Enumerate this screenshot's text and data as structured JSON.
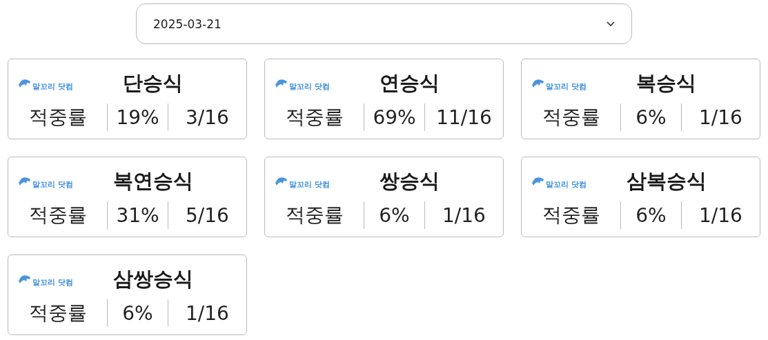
{
  "date_select": {
    "value": "2025-03-21"
  },
  "cards": [
    {
      "logo": "말꼬리 닷컴",
      "title": "단승식",
      "label": "적중률",
      "rate": "19%",
      "count": "3/16"
    },
    {
      "logo": "말꼬리 닷컴",
      "title": "연승식",
      "label": "적중률",
      "rate": "69%",
      "count": "11/16"
    },
    {
      "logo": "말꼬리 닷컴",
      "title": "복승식",
      "label": "적중률",
      "rate": "6%",
      "count": "1/16"
    },
    {
      "logo": "말꼬리 닷컴",
      "title": "복연승식",
      "label": "적중률",
      "rate": "31%",
      "count": "5/16"
    },
    {
      "logo": "말꼬리 닷컴",
      "title": "쌍승식",
      "label": "적중률",
      "rate": "6%",
      "count": "1/16"
    },
    {
      "logo": "말꼬리 닷컴",
      "title": "삼복승식",
      "label": "적중률",
      "rate": "6%",
      "count": "1/16"
    },
    {
      "logo": "말꼬리 닷컴",
      "title": "삼쌍승식",
      "label": "적중률",
      "rate": "6%",
      "count": "1/16"
    }
  ]
}
